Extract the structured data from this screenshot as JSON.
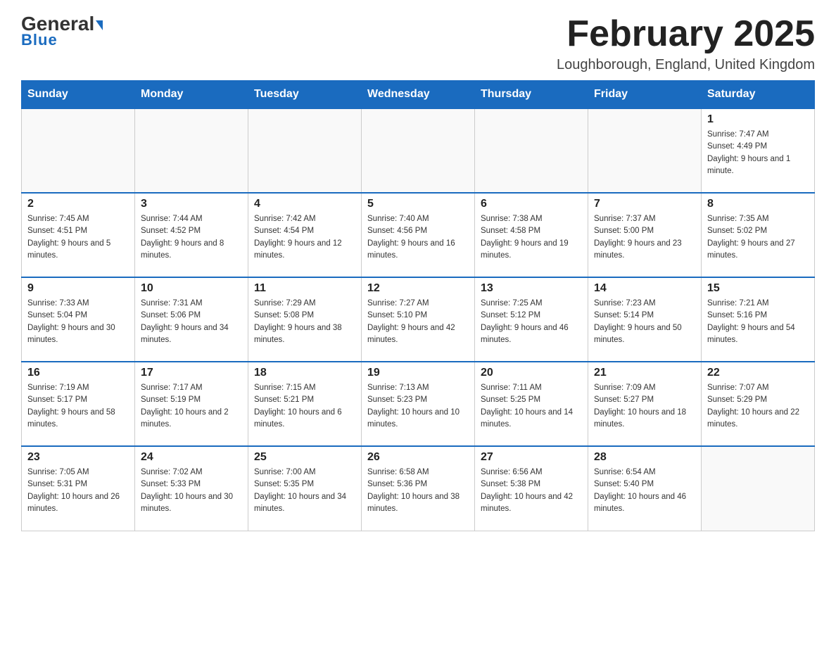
{
  "header": {
    "logo_text1": "General",
    "logo_text2": "Blue",
    "month_title": "February 2025",
    "location": "Loughborough, England, United Kingdom"
  },
  "weekdays": [
    "Sunday",
    "Monday",
    "Tuesday",
    "Wednesday",
    "Thursday",
    "Friday",
    "Saturday"
  ],
  "weeks": [
    [
      {
        "day": "",
        "sunrise": "",
        "sunset": "",
        "daylight": ""
      },
      {
        "day": "",
        "sunrise": "",
        "sunset": "",
        "daylight": ""
      },
      {
        "day": "",
        "sunrise": "",
        "sunset": "",
        "daylight": ""
      },
      {
        "day": "",
        "sunrise": "",
        "sunset": "",
        "daylight": ""
      },
      {
        "day": "",
        "sunrise": "",
        "sunset": "",
        "daylight": ""
      },
      {
        "day": "",
        "sunrise": "",
        "sunset": "",
        "daylight": ""
      },
      {
        "day": "1",
        "sunrise": "Sunrise: 7:47 AM",
        "sunset": "Sunset: 4:49 PM",
        "daylight": "Daylight: 9 hours and 1 minute."
      }
    ],
    [
      {
        "day": "2",
        "sunrise": "Sunrise: 7:45 AM",
        "sunset": "Sunset: 4:51 PM",
        "daylight": "Daylight: 9 hours and 5 minutes."
      },
      {
        "day": "3",
        "sunrise": "Sunrise: 7:44 AM",
        "sunset": "Sunset: 4:52 PM",
        "daylight": "Daylight: 9 hours and 8 minutes."
      },
      {
        "day": "4",
        "sunrise": "Sunrise: 7:42 AM",
        "sunset": "Sunset: 4:54 PM",
        "daylight": "Daylight: 9 hours and 12 minutes."
      },
      {
        "day": "5",
        "sunrise": "Sunrise: 7:40 AM",
        "sunset": "Sunset: 4:56 PM",
        "daylight": "Daylight: 9 hours and 16 minutes."
      },
      {
        "day": "6",
        "sunrise": "Sunrise: 7:38 AM",
        "sunset": "Sunset: 4:58 PM",
        "daylight": "Daylight: 9 hours and 19 minutes."
      },
      {
        "day": "7",
        "sunrise": "Sunrise: 7:37 AM",
        "sunset": "Sunset: 5:00 PM",
        "daylight": "Daylight: 9 hours and 23 minutes."
      },
      {
        "day": "8",
        "sunrise": "Sunrise: 7:35 AM",
        "sunset": "Sunset: 5:02 PM",
        "daylight": "Daylight: 9 hours and 27 minutes."
      }
    ],
    [
      {
        "day": "9",
        "sunrise": "Sunrise: 7:33 AM",
        "sunset": "Sunset: 5:04 PM",
        "daylight": "Daylight: 9 hours and 30 minutes."
      },
      {
        "day": "10",
        "sunrise": "Sunrise: 7:31 AM",
        "sunset": "Sunset: 5:06 PM",
        "daylight": "Daylight: 9 hours and 34 minutes."
      },
      {
        "day": "11",
        "sunrise": "Sunrise: 7:29 AM",
        "sunset": "Sunset: 5:08 PM",
        "daylight": "Daylight: 9 hours and 38 minutes."
      },
      {
        "day": "12",
        "sunrise": "Sunrise: 7:27 AM",
        "sunset": "Sunset: 5:10 PM",
        "daylight": "Daylight: 9 hours and 42 minutes."
      },
      {
        "day": "13",
        "sunrise": "Sunrise: 7:25 AM",
        "sunset": "Sunset: 5:12 PM",
        "daylight": "Daylight: 9 hours and 46 minutes."
      },
      {
        "day": "14",
        "sunrise": "Sunrise: 7:23 AM",
        "sunset": "Sunset: 5:14 PM",
        "daylight": "Daylight: 9 hours and 50 minutes."
      },
      {
        "day": "15",
        "sunrise": "Sunrise: 7:21 AM",
        "sunset": "Sunset: 5:16 PM",
        "daylight": "Daylight: 9 hours and 54 minutes."
      }
    ],
    [
      {
        "day": "16",
        "sunrise": "Sunrise: 7:19 AM",
        "sunset": "Sunset: 5:17 PM",
        "daylight": "Daylight: 9 hours and 58 minutes."
      },
      {
        "day": "17",
        "sunrise": "Sunrise: 7:17 AM",
        "sunset": "Sunset: 5:19 PM",
        "daylight": "Daylight: 10 hours and 2 minutes."
      },
      {
        "day": "18",
        "sunrise": "Sunrise: 7:15 AM",
        "sunset": "Sunset: 5:21 PM",
        "daylight": "Daylight: 10 hours and 6 minutes."
      },
      {
        "day": "19",
        "sunrise": "Sunrise: 7:13 AM",
        "sunset": "Sunset: 5:23 PM",
        "daylight": "Daylight: 10 hours and 10 minutes."
      },
      {
        "day": "20",
        "sunrise": "Sunrise: 7:11 AM",
        "sunset": "Sunset: 5:25 PM",
        "daylight": "Daylight: 10 hours and 14 minutes."
      },
      {
        "day": "21",
        "sunrise": "Sunrise: 7:09 AM",
        "sunset": "Sunset: 5:27 PM",
        "daylight": "Daylight: 10 hours and 18 minutes."
      },
      {
        "day": "22",
        "sunrise": "Sunrise: 7:07 AM",
        "sunset": "Sunset: 5:29 PM",
        "daylight": "Daylight: 10 hours and 22 minutes."
      }
    ],
    [
      {
        "day": "23",
        "sunrise": "Sunrise: 7:05 AM",
        "sunset": "Sunset: 5:31 PM",
        "daylight": "Daylight: 10 hours and 26 minutes."
      },
      {
        "day": "24",
        "sunrise": "Sunrise: 7:02 AM",
        "sunset": "Sunset: 5:33 PM",
        "daylight": "Daylight: 10 hours and 30 minutes."
      },
      {
        "day": "25",
        "sunrise": "Sunrise: 7:00 AM",
        "sunset": "Sunset: 5:35 PM",
        "daylight": "Daylight: 10 hours and 34 minutes."
      },
      {
        "day": "26",
        "sunrise": "Sunrise: 6:58 AM",
        "sunset": "Sunset: 5:36 PM",
        "daylight": "Daylight: 10 hours and 38 minutes."
      },
      {
        "day": "27",
        "sunrise": "Sunrise: 6:56 AM",
        "sunset": "Sunset: 5:38 PM",
        "daylight": "Daylight: 10 hours and 42 minutes."
      },
      {
        "day": "28",
        "sunrise": "Sunrise: 6:54 AM",
        "sunset": "Sunset: 5:40 PM",
        "daylight": "Daylight: 10 hours and 46 minutes."
      },
      {
        "day": "",
        "sunrise": "",
        "sunset": "",
        "daylight": ""
      }
    ]
  ]
}
